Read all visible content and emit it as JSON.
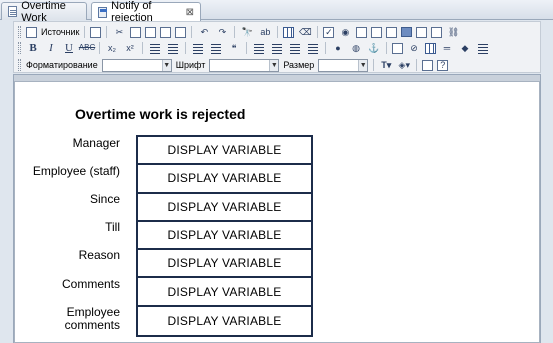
{
  "tabs": [
    {
      "label": "Overtime Work",
      "active": false
    },
    {
      "label": "Notify of rejection",
      "active": true
    }
  ],
  "toolbar": {
    "source_label": "Источник",
    "format_label": "Форматирование",
    "font_label": "Шрифт",
    "size_label": "Размер",
    "format_value": "",
    "font_value": "",
    "size_value": ""
  },
  "form": {
    "title": "Overtime work is rejected",
    "fields": [
      {
        "label": "Manager",
        "value": "DISPLAY VARIABLE"
      },
      {
        "label": "Employee (staff)",
        "value": "DISPLAY VARIABLE"
      },
      {
        "label": "Since",
        "value": "DISPLAY VARIABLE"
      },
      {
        "label": "Till",
        "value": "DISPLAY VARIABLE"
      },
      {
        "label": "Reason",
        "value": "DISPLAY VARIABLE"
      },
      {
        "label": "Comments",
        "value": "DISPLAY VARIABLE"
      },
      {
        "label": "Employee comments",
        "value": "DISPLAY VARIABLE"
      }
    ]
  }
}
